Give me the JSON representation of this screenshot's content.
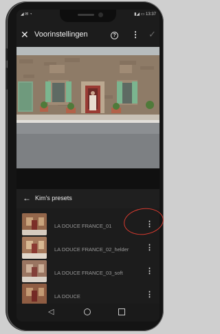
{
  "status_bar": {
    "left_icons": "◢ ✉ ◔",
    "right_text": "▮◢ ▭ 13:37"
  },
  "header": {
    "title": "Voorinstellingen",
    "close_glyph": "✕",
    "help_glyph": "?",
    "more_glyph": "⋮",
    "confirm_glyph": "✓"
  },
  "presets_panel": {
    "back_glyph": "←",
    "group_label": "Kim's presets",
    "items": [
      {
        "name": "LA DOUCE FRANCE_01",
        "menu_glyph": "⋮"
      },
      {
        "name": "LA DOUCE FRANCE_02_helder",
        "menu_glyph": "⋮"
      },
      {
        "name": "LA DOUCE FRANCE_03_soft",
        "menu_glyph": "⋮"
      },
      {
        "name": "LA DOUCE",
        "menu_glyph": "⋮"
      }
    ]
  },
  "navigation": {
    "back_glyph": "◁"
  },
  "colors": {
    "annotation": "#d53a2f",
    "background": "#1c1c1c"
  }
}
